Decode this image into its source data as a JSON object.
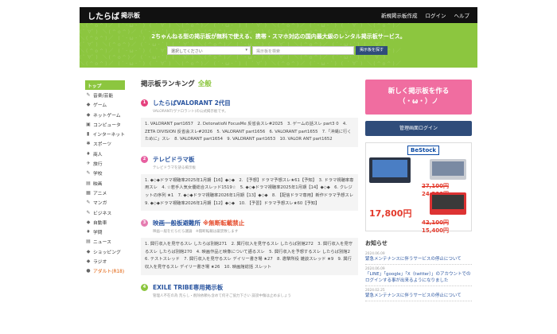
{
  "header": {
    "logo": "したらば",
    "logo_sub": "掲示板",
    "links": [
      "新規掲示板作成",
      "ログイン",
      "ヘルプ"
    ]
  },
  "hero": {
    "tagline": "2ちゃんねる型の掲示板が無料で使える、携帯・スマホ対応の国内最大級のレンタル掲示板サービス。",
    "select_placeholder": "選択してください",
    "search_placeholder": "掲示板を検索",
    "search_button": "掲示板を探す"
  },
  "sidebar": {
    "items": [
      {
        "icon": "",
        "label": "トップ"
      },
      {
        "icon": "✎",
        "label": "音楽/芸能"
      },
      {
        "icon": "◆",
        "label": "ゲーム"
      },
      {
        "icon": "◆",
        "label": "ネットゲーム"
      },
      {
        "icon": "▣",
        "label": "コンピュータ"
      },
      {
        "icon": "▮",
        "label": "インターネット"
      },
      {
        "icon": "✱",
        "label": "スポーツ"
      },
      {
        "icon": "♦",
        "label": "商人"
      },
      {
        "icon": "✈",
        "label": "旅行"
      },
      {
        "icon": "✎",
        "label": "学校"
      },
      {
        "icon": "▤",
        "label": "映画"
      },
      {
        "icon": "▦",
        "label": "アニメ"
      },
      {
        "icon": "✎",
        "label": "マンガ"
      },
      {
        "icon": "✎",
        "label": "ビジネス"
      },
      {
        "icon": "◆",
        "label": "自動車"
      },
      {
        "icon": "♦",
        "label": "学問"
      },
      {
        "icon": "▤",
        "label": "ニュース"
      },
      {
        "icon": "◆",
        "label": "ショッピング"
      },
      {
        "icon": "◆",
        "label": "ラジオ"
      },
      {
        "icon": "●",
        "label": "アダルト(R18)"
      }
    ]
  },
  "main": {
    "title": "掲示板ランキング",
    "title_scope": "全般",
    "rankings": [
      {
        "num": "1",
        "color": "#e5417e",
        "name": "したらばVALORANT 2代目",
        "warn": "",
        "sub": "VALORANT(ヴァロラント)の公式掲示板です。",
        "threads": "1. VALORANT part1657　2. DetonatioN FocusMe 反省会スレ#2025　3. ゲームの話スレ part3 0　4. ZETA DIVISION 反省会スレ#2026　5. VALORANT part1656　6. VALORANT part1655　7.「沖縄に行くために」スレ　8. VALORANT part1654　9. VALORANT part1653　10. VALOR ANT part1652"
      },
      {
        "num": "2",
        "color": "#e75fa0",
        "name": "テレビドラマ板",
        "warn": "",
        "sub": "テレビドラマを語る掲示板",
        "threads": "1. ◆◇◆ドラマ視聴率2025年1月期【16】◆◇◆　2. 【予想】ドラマ予想スレ★61【予知】　3. ドラマ視聴率専用スレ　4. ☆若手人気女優総合スレッド1519☆　5. ◆◇◆ドラマ視聴率2025年1月期【14】◆◇◆　6. クレジットの序列 ★1　7. ◆◇◆ドラマ視聴率2026年1月期【13】◆◇◆　8. 【配信ドラマ専用】新作ドラマ予想スレ　9. ◆◇◆ドラマ視聴率2026年1月期【12】◆◇◆　10. 【予習】ドラマ予想スレ★60【予知】"
      },
      {
        "num": "3",
        "color": "#e57cb0",
        "name": "映画一般板避難所",
        "warn": "※無断転載禁止",
        "sub": "映画一般をだらだら議論　※無断転載は厳禁致します",
        "threads": "1. 興行収入を見守るスレ したらば別館271　2. 興行収入を見守るスレ したらば別館272　3. 興行収入を見守るスレ したらば別館270　4. 映画作品と映像について語るスレ　5. 興行収入を予想するスレ したらば別館2　6. テストスレッド　7. 興行収入を見守るスレ デイリー書き場 ★27　8. 邀撃所役 雑談スレッド ★9　9. 興行収入を見守るスレ デイリー書き場 ★26　10. 映画館総括 スレット"
      },
      {
        "num": "4",
        "color": "#8cc63f",
        "name": "EXILE TRIBE専用掲示板",
        "warn": "",
        "sub": "管理人不在の為 荒らし・削除依頼も含めて何ぞご協力下さい 誹謗中傷は止めましょう",
        "threads": ""
      }
    ]
  },
  "right": {
    "create_label": "新しく掲示板を作る",
    "create_face": "（・ω・）ノ",
    "admin_label": "管理画面ログイン",
    "ad": {
      "logo": "BeStock",
      "price1_old": "27,100円",
      "price1_new": "24,200円",
      "big_price": "17,800円",
      "price2_old": "42,100円",
      "price2_new": "15,400円"
    },
    "notice_title": "お知らせ",
    "notices": [
      {
        "date": "2024.06.09",
        "text": "緊急メンテナンスに伴うサービスの停止について"
      },
      {
        "date": "2024.06.09",
        "text": "「LINE」「google」「X（twitter）」のアカウントでのログインする事が出来るようになりました"
      },
      {
        "date": "2024.02.25",
        "text": "緊急メンテナンスに伴うサービスの停止について"
      }
    ]
  }
}
